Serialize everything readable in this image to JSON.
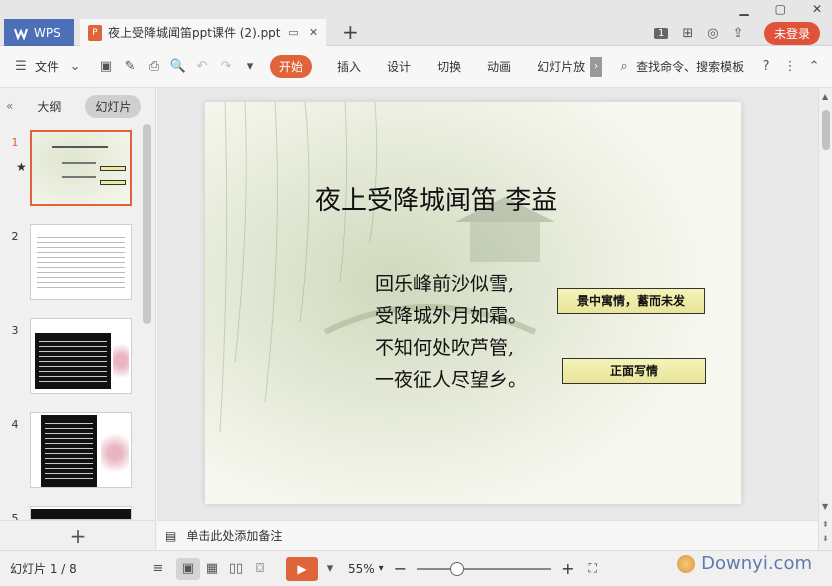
{
  "titlebar": {
    "app_tab": "WPS",
    "doc_tab": "夜上受降城闻笛ppt课件 (2).ppt",
    "badge": "1",
    "login": "未登录"
  },
  "menubar": {
    "file": "文件",
    "start": "开始",
    "items": [
      "插入",
      "设计",
      "切换",
      "动画",
      "幻灯片放"
    ],
    "search": "查找命令、搜索模板"
  },
  "panel": {
    "tab_outline": "大纲",
    "tab_slides": "幻灯片",
    "slides": [
      "1",
      "2",
      "3",
      "4",
      "5"
    ]
  },
  "slide": {
    "title": "夜上受降城闻笛 李益",
    "poem": [
      "回乐峰前沙似雪,",
      "受降城外月如霜。",
      "不知何处吹芦管,",
      "一夜征人尽望乡。"
    ],
    "tag1": "景中寓情，蓄而未发",
    "tag2": "正面写情"
  },
  "notes": {
    "placeholder": "单击此处添加备注"
  },
  "status": {
    "slide_counter": "幻灯片 1 / 8",
    "zoom": "55%",
    "zoom_level": 0.3,
    "watermark": "Downyi.com"
  },
  "colors": {
    "accent": "#e0643a",
    "wps_blue": "#4c6fb8"
  }
}
